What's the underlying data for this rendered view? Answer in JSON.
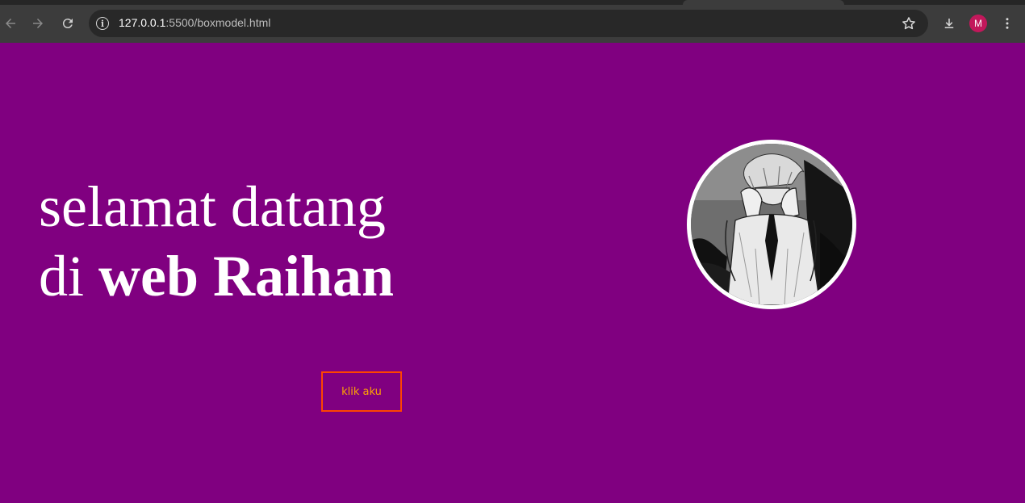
{
  "browser": {
    "url_host": "127.0.0.1",
    "url_rest": ":5500/boxmodel.html",
    "avatar_initial": "M"
  },
  "page": {
    "background": "#800080",
    "headline_line1": "selamat datang",
    "headline_line2_plain": "di ",
    "headline_line2_bold": "web Raihan",
    "button_label": "klik aku",
    "button_border_color": "#ff4500",
    "button_text_color": "#ffa500",
    "profile_image_icon": "manga-character-portrait"
  }
}
